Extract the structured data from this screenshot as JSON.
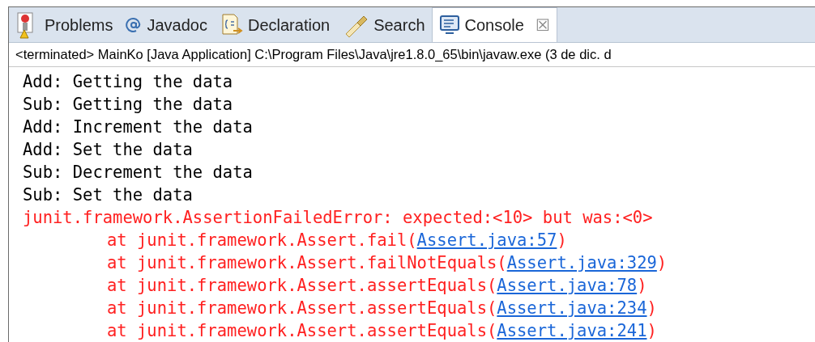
{
  "tabs": [
    {
      "label": "Problems",
      "kind": "problems",
      "selected": false
    },
    {
      "label": "Javadoc",
      "kind": "at",
      "selected": false
    },
    {
      "label": "Declaration",
      "kind": "declaration",
      "selected": false
    },
    {
      "label": "Search",
      "kind": "search",
      "selected": false
    },
    {
      "label": "Console",
      "kind": "console",
      "selected": true,
      "close": "☒"
    }
  ],
  "console_header": "<terminated> MainKo [Java Application] C:\\Program Files\\Java\\jre1.8.0_65\\bin\\javaw.exe (3 de dic. d",
  "lines": [
    {
      "kind": "output",
      "text": "Add: Getting the data"
    },
    {
      "kind": "output",
      "text": "Sub: Getting the data"
    },
    {
      "kind": "output",
      "text": "Add: Increment the data"
    },
    {
      "kind": "output",
      "text": "Add: Set the data"
    },
    {
      "kind": "output",
      "text": "Sub: Decrement the data"
    },
    {
      "kind": "output",
      "text": "Sub: Set the data"
    },
    {
      "kind": "error",
      "text": "junit.framework.AssertionFailedError: expected:<10> but was:<0>"
    },
    {
      "kind": "trace",
      "text": "at junit.framework.Assert.fail(",
      "link": "Assert.java:57",
      "end": ")"
    },
    {
      "kind": "trace",
      "text": "at junit.framework.Assert.failNotEquals(",
      "link": "Assert.java:329",
      "end": ")"
    },
    {
      "kind": "trace",
      "text": "at junit.framework.Assert.assertEquals(",
      "link": "Assert.java:78",
      "end": ")"
    },
    {
      "kind": "trace",
      "text": "at junit.framework.Assert.assertEquals(",
      "link": "Assert.java:234",
      "end": ")"
    },
    {
      "kind": "trace",
      "text": "at junit.framework.Assert.assertEquals(",
      "link": "Assert.java:241",
      "end": ")"
    }
  ]
}
